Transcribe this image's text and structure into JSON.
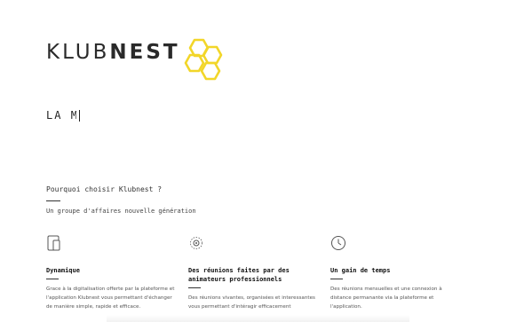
{
  "logo": {
    "text_light": "KLUB",
    "text_bold": "NEST",
    "accent": "#f2d629"
  },
  "hero": {
    "typed_text": "LA",
    "partial_char": "M"
  },
  "why": {
    "title": "Pourquoi choisir Klubnest ?",
    "subtitle": "Un groupe d'affaires nouvelle génération"
  },
  "features": [
    {
      "icon": "tablet-icon",
      "title": "Dynamique",
      "desc": "Grace à la digitalisation offerte par la plateforme et l'application Klubnest vous permettant d'échanger de manière simple, rapide et efficace."
    },
    {
      "icon": "meeting-icon",
      "title": "Des réunions faites par des animateurs professionnels",
      "desc": "Des réunions vivantes, organisées et interessantes vous permettant d'intéragir efficacement"
    },
    {
      "icon": "clock-icon",
      "title": "Un gain de temps",
      "desc": "Des réunions mensuelles et une connexion à distance permanante via la plateforme et l'application."
    }
  ]
}
